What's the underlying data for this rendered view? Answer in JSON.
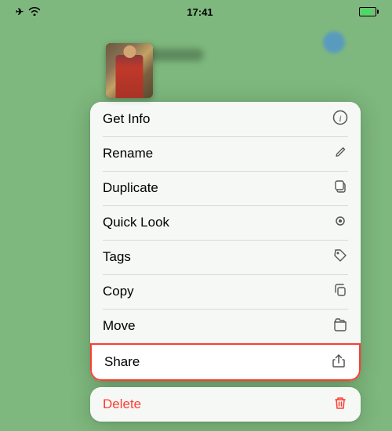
{
  "statusBar": {
    "time": "17:41",
    "icons": {
      "airplane": "✈",
      "wifi": "wifi"
    }
  },
  "menu": {
    "items": [
      {
        "id": "get-info",
        "label": "Get Info",
        "icon": "ℹ"
      },
      {
        "id": "rename",
        "label": "Rename",
        "icon": "✏"
      },
      {
        "id": "duplicate",
        "label": "Duplicate",
        "icon": "⧉"
      },
      {
        "id": "quick-look",
        "label": "Quick Look",
        "icon": "👁"
      },
      {
        "id": "tags",
        "label": "Tags",
        "icon": "◇"
      },
      {
        "id": "copy",
        "label": "Copy",
        "icon": "⎘"
      },
      {
        "id": "move",
        "label": "Move",
        "icon": "🗂"
      },
      {
        "id": "share",
        "label": "Share",
        "icon": "⬆"
      }
    ],
    "deleteItem": {
      "label": "Delete",
      "icon": "🗑"
    }
  }
}
